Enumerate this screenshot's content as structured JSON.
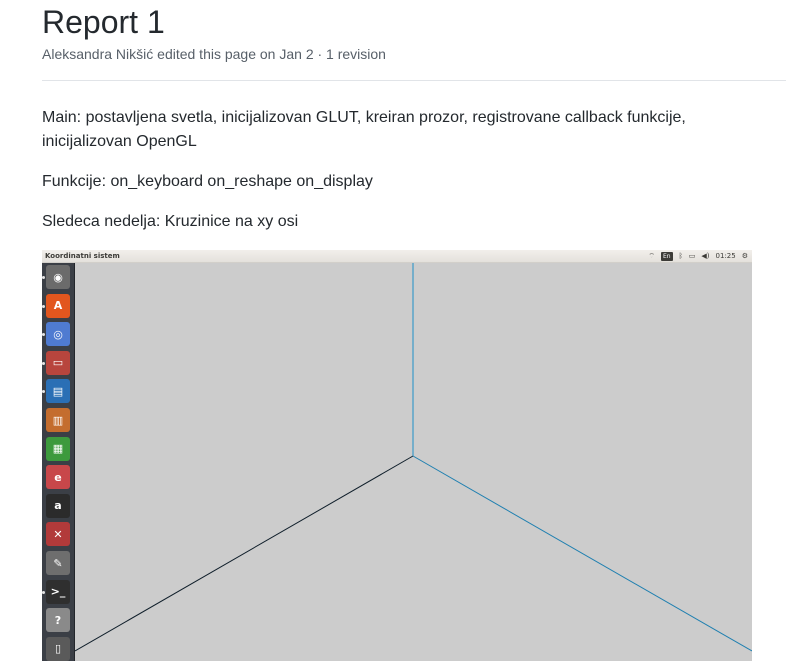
{
  "page": {
    "title": "Report 1",
    "meta": "Aleksandra Nikšić edited this page on Jan 2 · 1 revision",
    "paragraphs": [
      "Main: postavljena svetla, inicijalizovan GLUT, kreiran prozor, registrovane callback funkcije, inicijalizovan OpenGL",
      "Funkcije: on_keyboard on_reshape on_display",
      "Sledeca nedelja: Kruzinice na xy osi"
    ]
  },
  "screenshot": {
    "window_title": "Koordinatni sistem",
    "tray": {
      "keyboard_layout": "En",
      "clock": "01:25"
    },
    "launcher_items": [
      {
        "icon": "ubuntu-dash-icon",
        "bg": "#6b6b6b",
        "glyph": "◉"
      },
      {
        "icon": "software-center-icon",
        "bg": "#e2561e",
        "glyph": "A"
      },
      {
        "icon": "chromium-icon",
        "bg": "#4f7bd1",
        "glyph": "◎"
      },
      {
        "icon": "file-manager-icon",
        "bg": "#b8453d",
        "glyph": "▭"
      },
      {
        "icon": "libreoffice-writer-icon",
        "bg": "#2a6fb5",
        "glyph": "▤"
      },
      {
        "icon": "libreoffice-impress-icon",
        "bg": "#c46d2e",
        "glyph": "▥"
      },
      {
        "icon": "libreoffice-calc-icon",
        "bg": "#3d9a3d",
        "glyph": "▦"
      },
      {
        "icon": "ubuntu-one-icon",
        "bg": "#c8474a",
        "glyph": "e"
      },
      {
        "icon": "amazon-icon",
        "bg": "#2b2b2b",
        "glyph": "a"
      },
      {
        "icon": "system-settings-icon",
        "bg": "#b23a3a",
        "glyph": "✕"
      },
      {
        "icon": "text-editor-icon",
        "bg": "#6e6e6e",
        "glyph": "✎"
      },
      {
        "icon": "terminal-icon",
        "bg": "#2f2f2f",
        "glyph": ">_"
      },
      {
        "icon": "help-icon",
        "bg": "#8a8a8a",
        "glyph": "?"
      },
      {
        "icon": "trash-icon",
        "bg": "#5a5a5a",
        "glyph": "▯"
      }
    ],
    "colors": {
      "gl_background": "#cccccc",
      "z_axis": "#1e90c8",
      "x_axis": "#0f1e2a",
      "y_axis": "#1e7fb0"
    }
  }
}
